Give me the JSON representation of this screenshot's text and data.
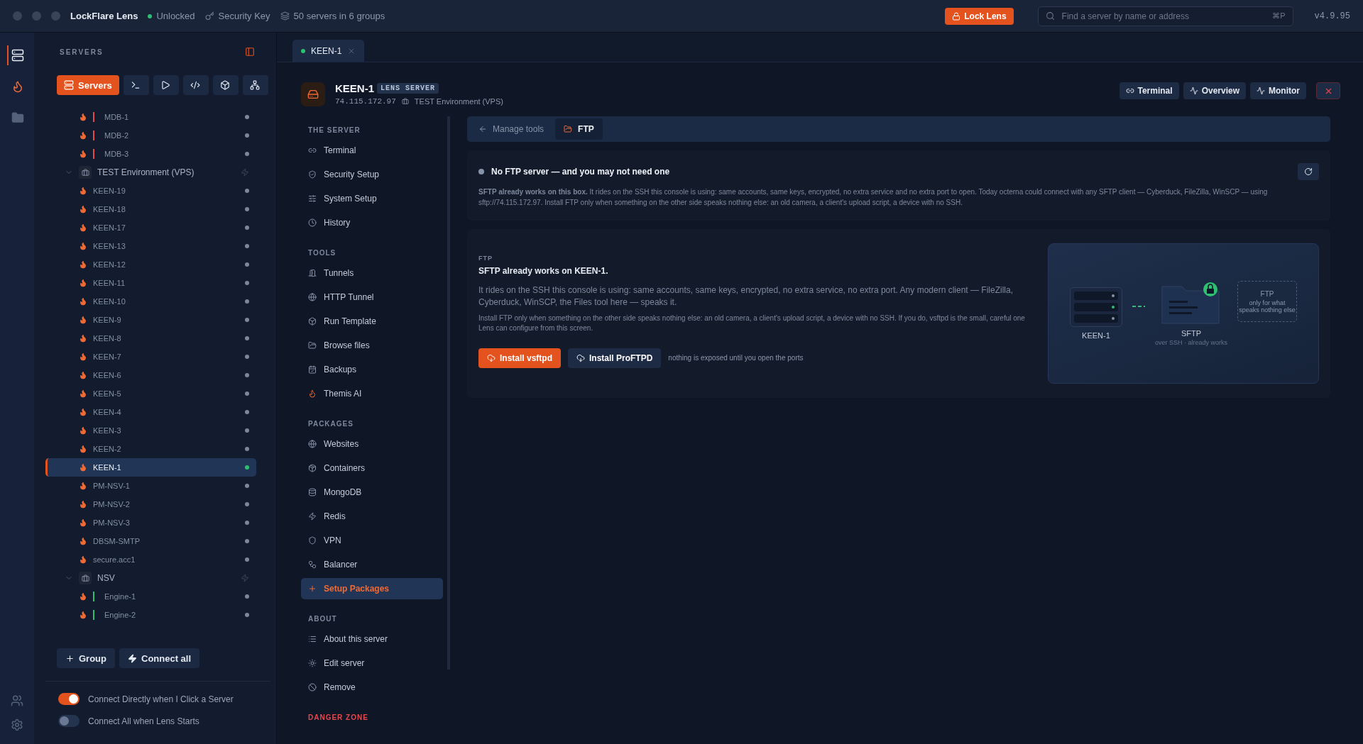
{
  "titlebar": {
    "app": "LockFlare Lens",
    "lock_state": "Unlocked",
    "unlocked": true,
    "key": "Security Key",
    "summary": "50 servers in 6 groups",
    "lock_button": "Lock Lens",
    "search": {
      "placeholder": "Find a server by name or address",
      "shortcut": "⌘P"
    },
    "version": "v4.9.95"
  },
  "rail": [
    {
      "selected": true
    },
    {
      "selected": false
    },
    {
      "selected": false
    }
  ],
  "sidebar": {
    "heading": "SERVERS",
    "views": [
      {
        "label": "Servers",
        "selected": true
      },
      {
        "selected": false
      },
      {
        "selected": false
      },
      {
        "selected": false
      },
      {
        "selected": false
      },
      {
        "selected": false
      }
    ],
    "tree": [
      {
        "kind": "group",
        "children": [
          {
            "kind": "server",
            "name": "MDB-1",
            "color": "#e5484d",
            "online": false,
            "selected": false
          },
          {
            "kind": "server",
            "name": "MDB-2",
            "color": "#e5484d",
            "online": false,
            "selected": false
          },
          {
            "kind": "server",
            "name": "MDB-3",
            "color": "#e5484d",
            "online": false,
            "selected": false
          }
        ]
      },
      {
        "kind": "group",
        "label": "TEST Environment (VPS)",
        "expanded": true,
        "children": [
          {
            "kind": "server",
            "name": "KEEN-19",
            "online": false,
            "selected": false
          },
          {
            "kind": "server",
            "name": "KEEN-18",
            "online": false,
            "selected": false
          },
          {
            "kind": "server",
            "name": "KEEN-17",
            "online": false,
            "selected": false
          },
          {
            "kind": "server",
            "name": "KEEN-13",
            "online": false,
            "selected": false
          },
          {
            "kind": "server",
            "name": "KEEN-12",
            "online": false,
            "selected": false
          },
          {
            "kind": "server",
            "name": "KEEN-11",
            "online": false,
            "selected": false
          },
          {
            "kind": "server",
            "name": "KEEN-10",
            "online": false,
            "selected": false
          },
          {
            "kind": "server",
            "name": "KEEN-9",
            "online": false,
            "selected": false
          },
          {
            "kind": "server",
            "name": "KEEN-8",
            "online": false,
            "selected": false
          },
          {
            "kind": "server",
            "name": "KEEN-7",
            "online": false,
            "selected": false
          },
          {
            "kind": "server",
            "name": "KEEN-6",
            "online": false,
            "selected": false
          },
          {
            "kind": "server",
            "name": "KEEN-5",
            "online": false,
            "selected": false
          },
          {
            "kind": "server",
            "name": "KEEN-4",
            "online": false,
            "selected": false
          },
          {
            "kind": "server",
            "name": "KEEN-3",
            "online": false,
            "selected": false
          },
          {
            "kind": "server",
            "name": "KEEN-2",
            "online": false,
            "selected": false
          },
          {
            "kind": "server",
            "name": "KEEN-1",
            "online": true,
            "selected": true
          },
          {
            "kind": "server",
            "name": "PM-NSV-1",
            "online": false,
            "selected": false
          },
          {
            "kind": "server",
            "name": "PM-NSV-2",
            "online": false,
            "selected": false
          },
          {
            "kind": "server",
            "name": "PM-NSV-3",
            "online": false,
            "selected": false
          },
          {
            "kind": "server",
            "name": "DBSM-SMTP",
            "online": false,
            "selected": false
          },
          {
            "kind": "server",
            "name": "secure.acc1",
            "online": false,
            "selected": false
          }
        ]
      },
      {
        "kind": "group",
        "label": "NSV",
        "expanded": true,
        "children": [
          {
            "kind": "server",
            "name": "Engine-1",
            "color": "#2fbf71",
            "online": false,
            "selected": false
          },
          {
            "kind": "server",
            "name": "Engine-2",
            "color": "#2fbf71",
            "online": false,
            "selected": false
          }
        ]
      }
    ],
    "actions": [
      "Group",
      "Connect all"
    ],
    "toggles": [
      {
        "label": "Connect Directly when I Click a Server",
        "on": true
      },
      {
        "label": "Connect All when Lens Starts",
        "on": false
      }
    ]
  },
  "tabs": [
    {
      "label": "KEEN-1",
      "selected": true
    }
  ],
  "server": {
    "name": "KEEN-1",
    "badge": "LENS SERVER",
    "address": "74.115.172.97",
    "group": "TEST Environment (VPS)",
    "actions": [
      "Terminal",
      "Overview",
      "Monitor"
    ]
  },
  "nav": [
    {
      "heading": "THE SERVER",
      "items": [
        {
          "label": "Terminal",
          "selected": false
        },
        {
          "label": "Security Setup",
          "selected": false
        },
        {
          "label": "System Setup",
          "selected": false
        },
        {
          "label": "History",
          "selected": false
        }
      ]
    },
    {
      "heading": "TOOLS",
      "items": [
        {
          "label": "Tunnels",
          "selected": false
        },
        {
          "label": "HTTP Tunnel",
          "selected": false
        },
        {
          "label": "Run Template",
          "selected": false
        },
        {
          "label": "Browse files",
          "selected": false
        },
        {
          "label": "Backups",
          "selected": false
        },
        {
          "label": "Themis AI",
          "selected": false
        }
      ]
    },
    {
      "heading": "PACKAGES",
      "items": [
        {
          "label": "Websites",
          "selected": false
        },
        {
          "label": "Containers",
          "selected": false
        },
        {
          "label": "MongoDB",
          "selected": false
        },
        {
          "label": "Redis",
          "selected": false
        },
        {
          "label": "VPN",
          "selected": false
        },
        {
          "label": "Balancer",
          "selected": false
        },
        {
          "label": "Setup Packages",
          "selected": true
        }
      ]
    },
    {
      "heading": "ABOUT",
      "items": [
        {
          "label": "About this server",
          "selected": false
        },
        {
          "label": "Edit server",
          "selected": false
        },
        {
          "label": "Remove",
          "selected": false
        }
      ]
    },
    {
      "heading": "DANGER ZONE",
      "danger": true
    }
  ],
  "breadcrumb": [
    {
      "label": "Manage tools",
      "selected": false
    },
    {
      "label": "FTP",
      "selected": true
    }
  ],
  "status": {
    "title": "No FTP server — and you may not need one",
    "text": "**SFTP already works on this box.** It rides on the SSH this console is using: same accounts, same keys, encrypted, no extra service and no extra port to open. Today octerna could connect with any SFTP client — Cyberduck, FileZilla, WinSCP — using sftp://74.115.172.97. Install FTP only when something on the other side speaks nothing else: an old camera, a client's upload script, a device with no SSH."
  },
  "ftp": {
    "label": "FTP",
    "heading": "SFTP already works on KEEN-1.",
    "lead": "It rides on the SSH this console is using: same accounts, same keys, encrypted, no extra service, no extra port. Any modern client — FileZilla, Cyberduck, WinSCP, the Files tool here — speaks it.",
    "detail": "Install FTP only when something on the other side speaks nothing else: an old camera, a client's upload script, a device with no SSH. If you do, vsftpd is the small, careful one Lens can configure from this screen.",
    "buttons": [
      {
        "label": "Install vsftpd",
        "primary": true
      },
      {
        "label": "Install ProFTPD",
        "primary": false
      }
    ],
    "note": "nothing is exposed until you open the ports",
    "diagram": {
      "server": "KEEN-1",
      "sftp": "SFTP",
      "sftp_note": "over SSH · already works",
      "ftp": "FTP",
      "ftp_note": "only for what speaks nothing else"
    }
  }
}
